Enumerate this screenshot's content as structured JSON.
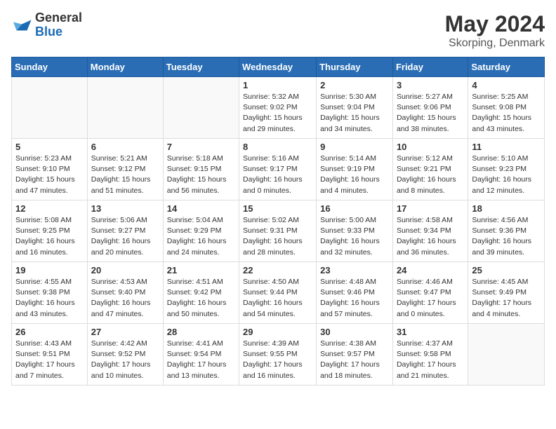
{
  "header": {
    "logo_general": "General",
    "logo_blue": "Blue",
    "month_year": "May 2024",
    "location": "Skorping, Denmark"
  },
  "days_of_week": [
    "Sunday",
    "Monday",
    "Tuesday",
    "Wednesday",
    "Thursday",
    "Friday",
    "Saturday"
  ],
  "weeks": [
    [
      {
        "day": "",
        "sunrise": "",
        "sunset": "",
        "daylight": ""
      },
      {
        "day": "",
        "sunrise": "",
        "sunset": "",
        "daylight": ""
      },
      {
        "day": "",
        "sunrise": "",
        "sunset": "",
        "daylight": ""
      },
      {
        "day": "1",
        "sunrise": "Sunrise: 5:32 AM",
        "sunset": "Sunset: 9:02 PM",
        "daylight": "Daylight: 15 hours and 29 minutes."
      },
      {
        "day": "2",
        "sunrise": "Sunrise: 5:30 AM",
        "sunset": "Sunset: 9:04 PM",
        "daylight": "Daylight: 15 hours and 34 minutes."
      },
      {
        "day": "3",
        "sunrise": "Sunrise: 5:27 AM",
        "sunset": "Sunset: 9:06 PM",
        "daylight": "Daylight: 15 hours and 38 minutes."
      },
      {
        "day": "4",
        "sunrise": "Sunrise: 5:25 AM",
        "sunset": "Sunset: 9:08 PM",
        "daylight": "Daylight: 15 hours and 43 minutes."
      }
    ],
    [
      {
        "day": "5",
        "sunrise": "Sunrise: 5:23 AM",
        "sunset": "Sunset: 9:10 PM",
        "daylight": "Daylight: 15 hours and 47 minutes."
      },
      {
        "day": "6",
        "sunrise": "Sunrise: 5:21 AM",
        "sunset": "Sunset: 9:12 PM",
        "daylight": "Daylight: 15 hours and 51 minutes."
      },
      {
        "day": "7",
        "sunrise": "Sunrise: 5:18 AM",
        "sunset": "Sunset: 9:15 PM",
        "daylight": "Daylight: 15 hours and 56 minutes."
      },
      {
        "day": "8",
        "sunrise": "Sunrise: 5:16 AM",
        "sunset": "Sunset: 9:17 PM",
        "daylight": "Daylight: 16 hours and 0 minutes."
      },
      {
        "day": "9",
        "sunrise": "Sunrise: 5:14 AM",
        "sunset": "Sunset: 9:19 PM",
        "daylight": "Daylight: 16 hours and 4 minutes."
      },
      {
        "day": "10",
        "sunrise": "Sunrise: 5:12 AM",
        "sunset": "Sunset: 9:21 PM",
        "daylight": "Daylight: 16 hours and 8 minutes."
      },
      {
        "day": "11",
        "sunrise": "Sunrise: 5:10 AM",
        "sunset": "Sunset: 9:23 PM",
        "daylight": "Daylight: 16 hours and 12 minutes."
      }
    ],
    [
      {
        "day": "12",
        "sunrise": "Sunrise: 5:08 AM",
        "sunset": "Sunset: 9:25 PM",
        "daylight": "Daylight: 16 hours and 16 minutes."
      },
      {
        "day": "13",
        "sunrise": "Sunrise: 5:06 AM",
        "sunset": "Sunset: 9:27 PM",
        "daylight": "Daylight: 16 hours and 20 minutes."
      },
      {
        "day": "14",
        "sunrise": "Sunrise: 5:04 AM",
        "sunset": "Sunset: 9:29 PM",
        "daylight": "Daylight: 16 hours and 24 minutes."
      },
      {
        "day": "15",
        "sunrise": "Sunrise: 5:02 AM",
        "sunset": "Sunset: 9:31 PM",
        "daylight": "Daylight: 16 hours and 28 minutes."
      },
      {
        "day": "16",
        "sunrise": "Sunrise: 5:00 AM",
        "sunset": "Sunset: 9:33 PM",
        "daylight": "Daylight: 16 hours and 32 minutes."
      },
      {
        "day": "17",
        "sunrise": "Sunrise: 4:58 AM",
        "sunset": "Sunset: 9:34 PM",
        "daylight": "Daylight: 16 hours and 36 minutes."
      },
      {
        "day": "18",
        "sunrise": "Sunrise: 4:56 AM",
        "sunset": "Sunset: 9:36 PM",
        "daylight": "Daylight: 16 hours and 39 minutes."
      }
    ],
    [
      {
        "day": "19",
        "sunrise": "Sunrise: 4:55 AM",
        "sunset": "Sunset: 9:38 PM",
        "daylight": "Daylight: 16 hours and 43 minutes."
      },
      {
        "day": "20",
        "sunrise": "Sunrise: 4:53 AM",
        "sunset": "Sunset: 9:40 PM",
        "daylight": "Daylight: 16 hours and 47 minutes."
      },
      {
        "day": "21",
        "sunrise": "Sunrise: 4:51 AM",
        "sunset": "Sunset: 9:42 PM",
        "daylight": "Daylight: 16 hours and 50 minutes."
      },
      {
        "day": "22",
        "sunrise": "Sunrise: 4:50 AM",
        "sunset": "Sunset: 9:44 PM",
        "daylight": "Daylight: 16 hours and 54 minutes."
      },
      {
        "day": "23",
        "sunrise": "Sunrise: 4:48 AM",
        "sunset": "Sunset: 9:46 PM",
        "daylight": "Daylight: 16 hours and 57 minutes."
      },
      {
        "day": "24",
        "sunrise": "Sunrise: 4:46 AM",
        "sunset": "Sunset: 9:47 PM",
        "daylight": "Daylight: 17 hours and 0 minutes."
      },
      {
        "day": "25",
        "sunrise": "Sunrise: 4:45 AM",
        "sunset": "Sunset: 9:49 PM",
        "daylight": "Daylight: 17 hours and 4 minutes."
      }
    ],
    [
      {
        "day": "26",
        "sunrise": "Sunrise: 4:43 AM",
        "sunset": "Sunset: 9:51 PM",
        "daylight": "Daylight: 17 hours and 7 minutes."
      },
      {
        "day": "27",
        "sunrise": "Sunrise: 4:42 AM",
        "sunset": "Sunset: 9:52 PM",
        "daylight": "Daylight: 17 hours and 10 minutes."
      },
      {
        "day": "28",
        "sunrise": "Sunrise: 4:41 AM",
        "sunset": "Sunset: 9:54 PM",
        "daylight": "Daylight: 17 hours and 13 minutes."
      },
      {
        "day": "29",
        "sunrise": "Sunrise: 4:39 AM",
        "sunset": "Sunset: 9:55 PM",
        "daylight": "Daylight: 17 hours and 16 minutes."
      },
      {
        "day": "30",
        "sunrise": "Sunrise: 4:38 AM",
        "sunset": "Sunset: 9:57 PM",
        "daylight": "Daylight: 17 hours and 18 minutes."
      },
      {
        "day": "31",
        "sunrise": "Sunrise: 4:37 AM",
        "sunset": "Sunset: 9:58 PM",
        "daylight": "Daylight: 17 hours and 21 minutes."
      },
      {
        "day": "",
        "sunrise": "",
        "sunset": "",
        "daylight": ""
      }
    ]
  ]
}
